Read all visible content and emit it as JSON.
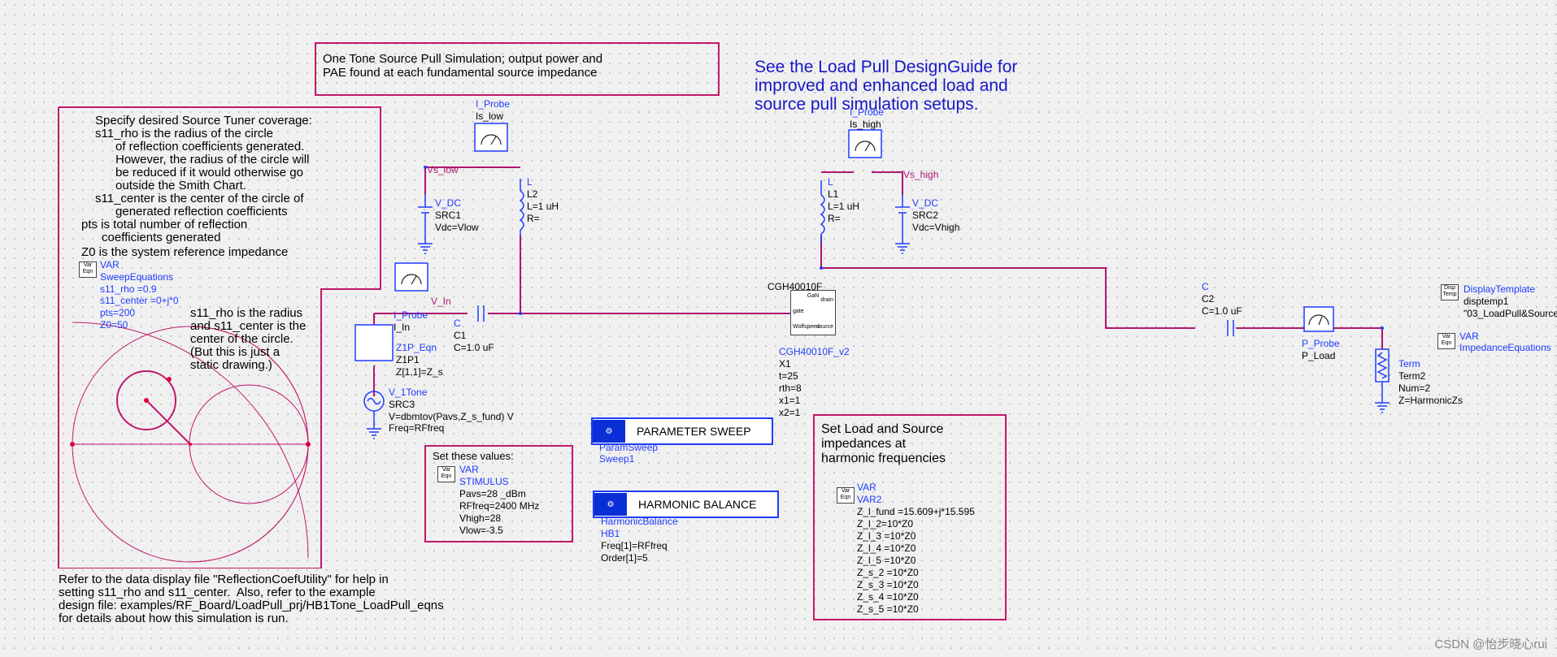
{
  "title_box": {
    "line1": "One Tone Source Pull Simulation; output power and",
    "line2": "PAE found at each fundamental source impedance"
  },
  "designguide_note": {
    "line1": "See the Load Pull DesignGuide for",
    "line2": "improved and enhanced load and",
    "line3": "source pull simulation setups."
  },
  "tuner_box": {
    "lines": [
      "Specify desired Source Tuner coverage:",
      "s11_rho is the radius of the circle",
      "      of reflection coefficients generated.",
      "      However, the radius of the circle will",
      "      be reduced if it would otherwise go",
      "      outside the Smith Chart.",
      "s11_center is the center of the circle of",
      "      generated reflection coefficients",
      "pts is total number of reflection",
      "      coefficients generated",
      "Z0 is the system reference impedance"
    ],
    "var_name": "VAR",
    "var_inst": "SweepEquations",
    "var_params": [
      "s11_rho =0.9",
      "s11_center =0+j*0",
      "pts=200",
      "Z0=50"
    ],
    "circle_note": [
      "s11_rho is the radius",
      "and s11_center is the",
      "center of the circle.",
      "(But this is just a",
      "static drawing.)"
    ]
  },
  "bottom_note": [
    "Refer to the data display file \"ReflectionCoefUtility\" for help in",
    "setting s11_rho and s11_center.  Also, refer to the example",
    "design file: examples/RF_Board/LoadPull_prj/HB1Tone_LoadPull_eqns",
    "for details about how this simulation is run."
  ],
  "probe_is_low": {
    "type": "I_Probe",
    "name": "Is_low"
  },
  "probe_is_high": {
    "type": "I_Probe",
    "name": "Is_high"
  },
  "net_vs_low": "Vs_low",
  "net_vs_high": "Vs_high",
  "net_v_in": "V_In",
  "src1": {
    "type": "V_DC",
    "name": "SRC1",
    "param": "Vdc=Vlow"
  },
  "src2": {
    "type": "V_DC",
    "name": "SRC2",
    "param": "Vdc=Vhigh"
  },
  "l2": {
    "type": "L",
    "name": "L2",
    "p1": "L=1 uH",
    "p2": "R="
  },
  "l1": {
    "type": "L",
    "name": "L1",
    "p1": "L=1 uH",
    "p2": "R="
  },
  "probe_i_in": {
    "type": "I_Probe",
    "name": "I_In"
  },
  "z1p": {
    "type": "Z1P_Eqn",
    "name": "Z1P1",
    "param": "Z[1,1]=Z_s"
  },
  "c1": {
    "type": "C",
    "name": "C1",
    "param": "C=1.0 uF"
  },
  "src3": {
    "type": "V_1Tone",
    "name": "SRC3",
    "p1": "V=dbmtov(Pavs,Z_s_fund) V",
    "p2": "Freq=RFfreq"
  },
  "transistor": {
    "model": "CGH40010F",
    "type": "CGH40010F_v2",
    "name": "X1",
    "params": [
      "t=25",
      "rth=8",
      "x1=1",
      "x2=1"
    ]
  },
  "chip_labels": {
    "brand": "GaN",
    "sub": "Wolfspeed",
    "pin1": "gate",
    "pin2": "drain",
    "pin3": "source"
  },
  "c2": {
    "type": "C",
    "name": "C2",
    "param": "C=1.0 uF"
  },
  "probe_load": {
    "type": "P_Probe",
    "name": "P_Load"
  },
  "term2": {
    "type": "Term",
    "name": "Term2",
    "p1": "Num=2",
    "p2": "Z=HarmonicZs"
  },
  "disp_template": {
    "type": "DisplayTemplate",
    "name": "disptemp1",
    "param": "\"03_LoadPull&Source"
  },
  "imp_eq": {
    "name": "VAR",
    "inst": "ImpedanceEquations"
  },
  "param_sweep": {
    "label": "PARAMETER SWEEP",
    "type": "ParamSweep",
    "name": "Sweep1"
  },
  "harmonic_balance": {
    "label": "HARMONIC BALANCE",
    "type": "HarmonicBalance",
    "name": "HB1",
    "p1": "Freq[1]=RFfreq",
    "p2": "Order[1]=5"
  },
  "stimulus_box": {
    "title": "Set these values:",
    "var": "VAR",
    "name": "STIMULUS",
    "params": [
      "Pavs=28 _dBm",
      "RFfreq=2400 MHz",
      "Vhigh=28",
      "Vlow=-3.5"
    ]
  },
  "harmonic_box": {
    "title": [
      "Set Load and Source",
      "impedances at",
      "harmonic frequencies"
    ],
    "var": "VAR",
    "name": "VAR2",
    "params": [
      "Z_l_fund =15.609+j*15.595",
      "Z_l_2=10*Z0",
      "Z_l_3 =10*Z0",
      "Z_l_4 =10*Z0",
      "Z_l_5 =10*Z0",
      "Z_s_2 =10*Z0",
      "Z_s_3 =10*Z0",
      "Z_s_4 =10*Z0",
      "Z_s_5 =10*Z0"
    ]
  },
  "icon_text": {
    "var": "Var\nEqn",
    "disp": "Disp\nTemp"
  },
  "watermark": "CSDN @怡步晓心rui",
  "colors": {
    "wire": "#b0156e",
    "component": "#1f3cff",
    "annotation_border": "#c2186b"
  }
}
